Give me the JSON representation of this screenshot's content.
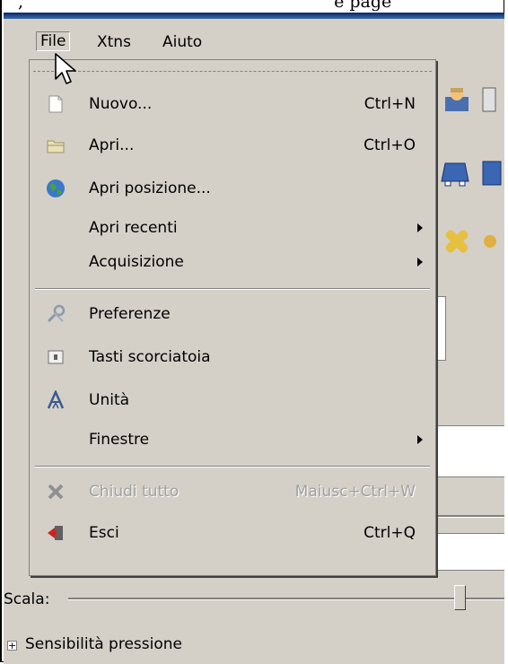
{
  "caption": {
    "fragment": "",
    "trail": "e page"
  },
  "menubar": {
    "file": "File",
    "xtns": "Xtns",
    "aiuto": "Aiuto"
  },
  "file_menu": {
    "items": [
      {
        "label": "Nuovo...",
        "shortcut": "Ctrl+N",
        "icon": "new-document-icon"
      },
      {
        "label": "Apri...",
        "shortcut": "Ctrl+O",
        "icon": "open-folder-icon"
      },
      {
        "label": "Apri posizione...",
        "shortcut": "",
        "icon": "globe-icon"
      },
      {
        "label": "Apri recenti",
        "shortcut": "",
        "icon": "",
        "submenu": true
      },
      {
        "label": "Acquisizione",
        "shortcut": "",
        "icon": "",
        "submenu": true
      },
      {
        "label": "Preferenze",
        "shortcut": "",
        "icon": "preferences-icon"
      },
      {
        "label": "Tasti scorciatoia",
        "shortcut": "",
        "icon": "keyboard-shortcuts-icon"
      },
      {
        "label": "Unità",
        "shortcut": "",
        "icon": "units-icon"
      },
      {
        "label": "Finestre",
        "shortcut": "",
        "icon": "",
        "submenu": true
      },
      {
        "label": "Chiudi tutto",
        "shortcut": "Maiusc+Ctrl+W",
        "icon": "close-all-icon",
        "disabled": true
      },
      {
        "label": "Esci",
        "shortcut": "Ctrl+Q",
        "icon": "quit-icon"
      }
    ]
  },
  "tool_options": {
    "scale_label": "Scala:",
    "pressure_label": "Sensibilità pressione"
  },
  "colors": {
    "window_bg": "#d4d0c8",
    "title_bar": "#0a246a"
  }
}
